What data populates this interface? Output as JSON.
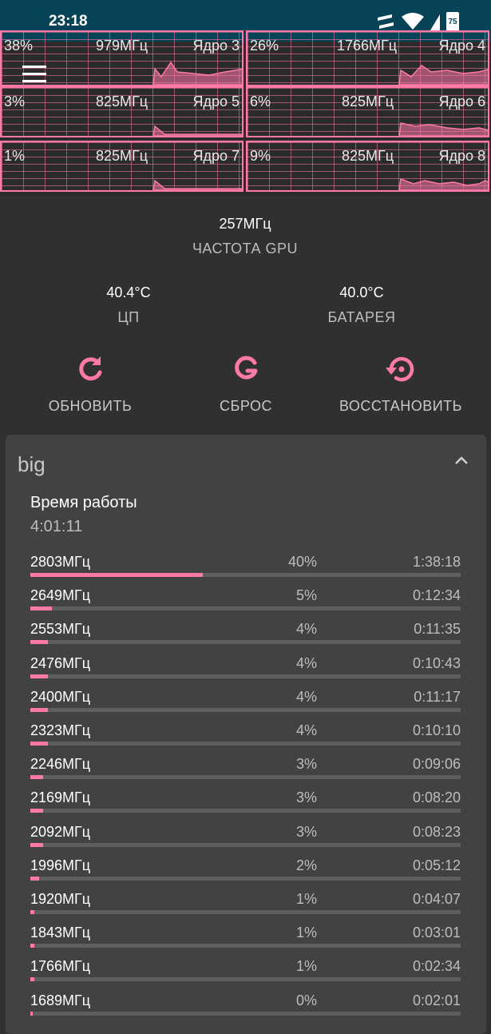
{
  "status_bar": {
    "time": "23:18",
    "battery": "75"
  },
  "cores": [
    {
      "percent": "38%",
      "freq": "979МГц",
      "label": "Ядро 3"
    },
    {
      "percent": "26%",
      "freq": "1766МГц",
      "label": "Ядро 4"
    },
    {
      "percent": "3%",
      "freq": "825МГц",
      "label": "Ядро 5"
    },
    {
      "percent": "6%",
      "freq": "825МГц",
      "label": "Ядро 6"
    },
    {
      "percent": "1%",
      "freq": "825МГц",
      "label": "Ядро 7"
    },
    {
      "percent": "9%",
      "freq": "825МГц",
      "label": "Ядро 8"
    }
  ],
  "gpu": {
    "value": "257МГц",
    "label": "ЧАСТОТА GPU"
  },
  "temps": {
    "cpu_value": "40.4°C",
    "cpu_label": "ЦП",
    "battery_value": "40.0°C",
    "battery_label": "БАТАРЕЯ"
  },
  "actions": {
    "refresh": "ОБНОВИТЬ",
    "reset": "СБРОС",
    "restore": "ВОССТАНОВИТЬ"
  },
  "colors": {
    "accent": "#ff79a8",
    "status_bar": "#064356",
    "background": "#303030",
    "card": "#424242"
  },
  "card": {
    "title": "big",
    "uptime_label": "Время работы",
    "uptime_value": "4:01:11",
    "states": [
      {
        "freq": "2803МГц",
        "percent": "40%",
        "time": "1:38:18",
        "fraction": 0.4
      },
      {
        "freq": "2649МГц",
        "percent": "5%",
        "time": "0:12:34",
        "fraction": 0.05
      },
      {
        "freq": "2553МГц",
        "percent": "4%",
        "time": "0:11:35",
        "fraction": 0.04
      },
      {
        "freq": "2476МГц",
        "percent": "4%",
        "time": "0:10:43",
        "fraction": 0.04
      },
      {
        "freq": "2400МГц",
        "percent": "4%",
        "time": "0:11:17",
        "fraction": 0.04
      },
      {
        "freq": "2323МГц",
        "percent": "4%",
        "time": "0:10:10",
        "fraction": 0.04
      },
      {
        "freq": "2246МГц",
        "percent": "3%",
        "time": "0:09:06",
        "fraction": 0.03
      },
      {
        "freq": "2169МГц",
        "percent": "3%",
        "time": "0:08:20",
        "fraction": 0.03
      },
      {
        "freq": "2092МГц",
        "percent": "3%",
        "time": "0:08:23",
        "fraction": 0.03
      },
      {
        "freq": "1996МГц",
        "percent": "2%",
        "time": "0:05:12",
        "fraction": 0.02
      },
      {
        "freq": "1920МГц",
        "percent": "1%",
        "time": "0:04:07",
        "fraction": 0.01
      },
      {
        "freq": "1843МГц",
        "percent": "1%",
        "time": "0:03:01",
        "fraction": 0.01
      },
      {
        "freq": "1766МГц",
        "percent": "1%",
        "time": "0:02:34",
        "fraction": 0.01
      },
      {
        "freq": "1689МГц",
        "percent": "0%",
        "time": "0:02:01",
        "fraction": 0.005
      }
    ]
  }
}
